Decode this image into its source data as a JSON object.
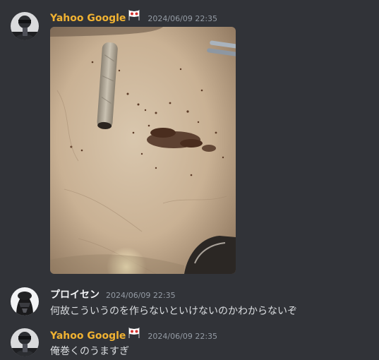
{
  "messages": [
    {
      "author": "Yahoo Google",
      "author_icon": "japan-flag-emoji-icon",
      "timestamp": "2024/06/09 22:35",
      "attachment": "image-attachment"
    },
    {
      "author": "プロイセン",
      "timestamp": "2024/06/09 22:35",
      "text": "何故こういうのを作らないといけないのかわからないぞ"
    },
    {
      "author": "Yahoo Google",
      "author_icon": "japan-flag-emoji-icon",
      "timestamp": "2024/06/09 22:35",
      "text": "俺巻くのうますぎ"
    }
  ],
  "colors": {
    "background": "#313338",
    "username_highlight": "#f0b232",
    "username_default": "#f2f3f5",
    "timestamp": "#949ba4",
    "message_text": "#dbdee1"
  }
}
